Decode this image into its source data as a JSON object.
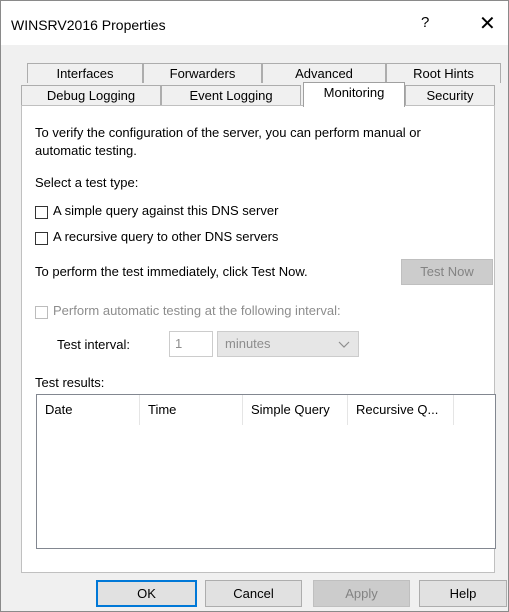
{
  "window": {
    "title": "WINSRV2016 Properties",
    "help_glyph": "?",
    "close_glyph": "✕"
  },
  "tabs_row1": [
    {
      "label": "Interfaces"
    },
    {
      "label": "Forwarders"
    },
    {
      "label": "Advanced"
    },
    {
      "label": "Root Hints"
    }
  ],
  "tabs_row2": [
    {
      "label": "Debug Logging"
    },
    {
      "label": "Event Logging"
    },
    {
      "label": "Monitoring",
      "active": true
    },
    {
      "label": "Security"
    }
  ],
  "monitoring": {
    "intro_line1": "To verify the configuration of the server, you can perform manual or",
    "intro_line2": "automatic testing.",
    "select_type_label": "Select a test type:",
    "simple_query_label": "A simple query against this DNS server",
    "simple_query_checked": false,
    "recursive_query_label": "A recursive query to other DNS servers",
    "recursive_query_checked": false,
    "test_now_prompt": "To perform the test immediately, click Test Now.",
    "test_now_button": "Test Now",
    "auto_test_label": "Perform automatic testing at the following interval:",
    "auto_test_checked": false,
    "interval_label": "Test interval:",
    "interval_value": "1",
    "interval_unit": "minutes",
    "results_label": "Test results:",
    "results_columns": [
      "Date",
      "Time",
      "Simple Query",
      "Recursive Q..."
    ]
  },
  "footer": {
    "ok": "OK",
    "cancel": "Cancel",
    "apply": "Apply",
    "help": "Help"
  },
  "colors": {
    "default_button_border": "#0078d7",
    "disabled_text": "#8d8d8d"
  }
}
